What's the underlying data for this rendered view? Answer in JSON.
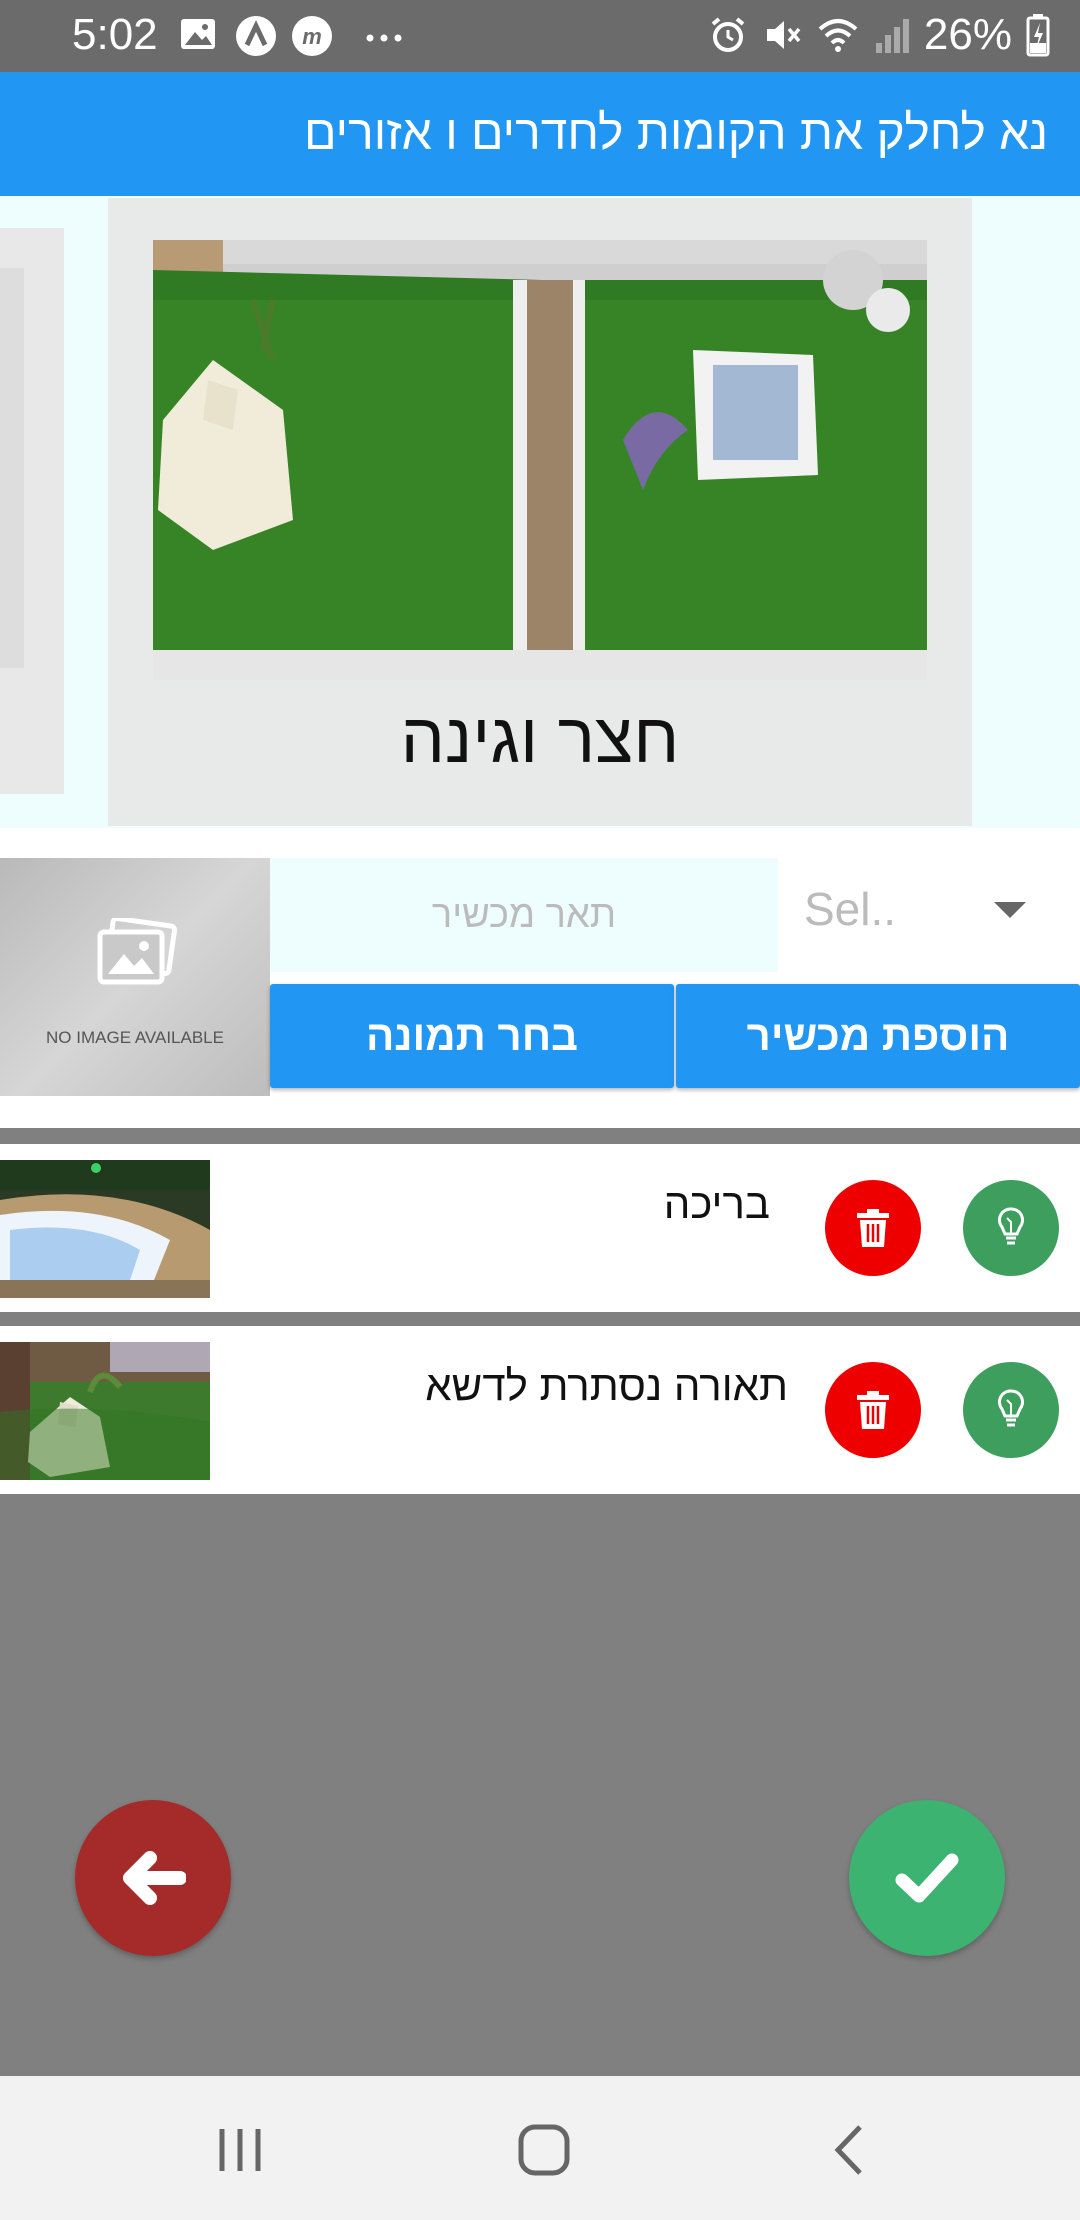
{
  "status_bar": {
    "time": "5:02",
    "battery": "26%",
    "left_icons": [
      "image-icon",
      "a-icon",
      "m-icon",
      "more-icon"
    ],
    "right_icons": [
      "alarm-icon",
      "mute-icon",
      "wifi-icon",
      "signal-icon",
      "battery-icon"
    ]
  },
  "header": {
    "title": "נא לחלק את הקומות לחדרים ו אזורים"
  },
  "carousel": {
    "current_room": "חצר וגינה"
  },
  "add_device": {
    "no_image_caption": "NO IMAGE AVAILABLE",
    "description_placeholder": "תאר מכשיר",
    "description_value": "",
    "select_value": "Sel..",
    "pick_image_label": "בחר תמונה",
    "add_device_label": "הוספת מכשיר"
  },
  "devices": [
    {
      "name": "בריכה"
    },
    {
      "name": "תאורה נסתרת לדשא"
    }
  ],
  "colors": {
    "primary": "#2196f3",
    "delete": "#ee0000",
    "light": "#3e9e5e",
    "back_fab": "#a52a2a",
    "confirm_fab": "#3cb371",
    "background": "#808080"
  }
}
